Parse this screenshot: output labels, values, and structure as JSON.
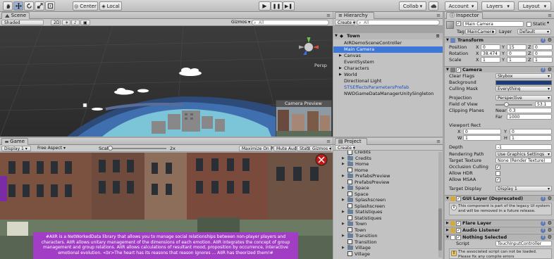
{
  "toolbar": {
    "tool_icons": [
      "hand-icon",
      "move-icon",
      "rotate-icon",
      "scale-icon",
      "rect-icon"
    ],
    "pivot_label": "Center",
    "space_label": "Local",
    "collab_label": "Collab",
    "account_label": "Account",
    "layers_label": "Layers",
    "layout_label": "Layout"
  },
  "scene": {
    "tab_label": "Scene",
    "shading_label": "Shaded",
    "mode_2d_label": "2D",
    "gizmos_label": "Gizmos",
    "search_placeholder": "All",
    "persp_label": "Persp",
    "camera_preview_label": "Camera Preview"
  },
  "game": {
    "tab_label": "Game",
    "display_label": "Display 1",
    "aspect_label": "Free Aspect",
    "scale_label": "Scale",
    "scale_value": "2x",
    "maximize_label": "Maximize On Play",
    "mute_label": "Mute Audio",
    "stats_label": "Stats",
    "gizmos_label": "Gizmos",
    "caption_text": "#AIIR is a NetWorkedData library that allows you to manage social relationships between non-player players and characters. AIIR allows unitary management of the dimensions of each emotion. AIIR integrates the concept of group management and group relations. AIIR allows calculations of resultant mood, proposition by occurrence, interactive emotional evolution. <br>The heart has its reasons that reason ignores ... AIIR has theorized them!#"
  },
  "hierarchy": {
    "tab_label": "Hierarchy",
    "create_label": "Create",
    "search_placeholder": "All",
    "scene_name": "Town",
    "items": [
      {
        "label": "AIRDemoSceneController",
        "selected": false,
        "blue": false,
        "arrow": false
      },
      {
        "label": "Main Camera",
        "selected": true,
        "blue": false,
        "arrow": false
      },
      {
        "label": "Canvas",
        "selected": false,
        "blue": false,
        "arrow": true
      },
      {
        "label": "EventSystem",
        "selected": false,
        "blue": false,
        "arrow": false
      },
      {
        "label": "Characters",
        "selected": false,
        "blue": false,
        "arrow": true
      },
      {
        "label": "World",
        "selected": false,
        "blue": false,
        "arrow": true
      },
      {
        "label": "Directional Light",
        "selected": false,
        "blue": false,
        "arrow": false
      },
      {
        "label": "STSEffectsParametersPrefab",
        "selected": false,
        "blue": true,
        "arrow": false
      },
      {
        "label": "NWDGameDataManagerUnitySingleton",
        "selected": false,
        "blue": false,
        "arrow": false
      }
    ]
  },
  "project": {
    "tab_label": "Project",
    "create_label": "Create",
    "items": [
      {
        "label": "Credits",
        "kind": "asset"
      },
      {
        "label": "Credits",
        "kind": "folder"
      },
      {
        "label": "Home",
        "kind": "folder"
      },
      {
        "label": "Home",
        "kind": "asset"
      },
      {
        "label": "PrefabsPreview",
        "kind": "folder"
      },
      {
        "label": "PrefabsPreview",
        "kind": "asset"
      },
      {
        "label": "Space",
        "kind": "folder"
      },
      {
        "label": "Space",
        "kind": "asset"
      },
      {
        "label": "Splashscreen",
        "kind": "folder"
      },
      {
        "label": "Splashscreen",
        "kind": "asset"
      },
      {
        "label": "Statistiques",
        "kind": "folder"
      },
      {
        "label": "Statistiques",
        "kind": "asset"
      },
      {
        "label": "Town",
        "kind": "folder"
      },
      {
        "label": "Town",
        "kind": "asset"
      },
      {
        "label": "Transition",
        "kind": "folder"
      },
      {
        "label": "Transition",
        "kind": "asset"
      },
      {
        "label": "Village",
        "kind": "folder"
      },
      {
        "label": "Village",
        "kind": "asset"
      }
    ]
  },
  "inspector": {
    "tab_label": "Inspector",
    "object_name": "Main Camera",
    "static_label": "Static",
    "tag_label": "Tag",
    "tag_value": "MainCamera",
    "layer_label": "Layer",
    "layer_value": "Default",
    "transform": {
      "title": "Transform",
      "position_label": "Position",
      "rotation_label": "Rotation",
      "scale_label": "Scale",
      "position": {
        "x": "0",
        "y": "15",
        "z": "0"
      },
      "rotation": {
        "x": "38.474",
        "y": "0",
        "z": "0"
      },
      "scale": {
        "x": "1",
        "y": "1",
        "z": "1"
      }
    },
    "camera": {
      "title": "Camera",
      "clear_flags_label": "Clear Flags",
      "clear_flags_value": "Skybox",
      "background_label": "Background",
      "background_color": "#1a3a7a",
      "culling_mask_label": "Culling Mask",
      "culling_mask_value": "Everything",
      "projection_label": "Projection",
      "projection_value": "Perspective",
      "fov_label": "Field of View",
      "fov_value": "53.1",
      "fov_fraction": 0.29,
      "clipping_label": "Clipping Planes",
      "near_label": "Near",
      "near_value": "0.3",
      "far_label": "Far",
      "far_value": "1000",
      "viewport_label": "Viewport Rect",
      "vp": {
        "x": "0",
        "y": "0",
        "w": "1",
        "h": "1"
      },
      "depth_label": "Depth",
      "depth_value": "-1",
      "rendering_path_label": "Rendering Path",
      "rendering_path_value": "Use Graphics Settings",
      "target_texture_label": "Target Texture",
      "target_texture_value": "None (Render Texture)",
      "occlusion_label": "Occlusion Culling",
      "hdr_label": "Allow HDR",
      "msaa_label": "Allow MSAA",
      "target_display_label": "Target Display",
      "target_display_value": "Display 1"
    },
    "gui_layer_title": "GUI Layer (Deprecated)",
    "gui_layer_warning": "This component is part of the legacy UI system and will be removed in a future release.",
    "flare_layer_title": "Flare Layer",
    "audio_listener_title": "Audio Listener",
    "nothing_selected_title": "Nothing Selected",
    "script_label": "Script",
    "script_value": "TouchInputController",
    "script_warning": "The associated script can not be loaded. Please fix any compile errors"
  }
}
